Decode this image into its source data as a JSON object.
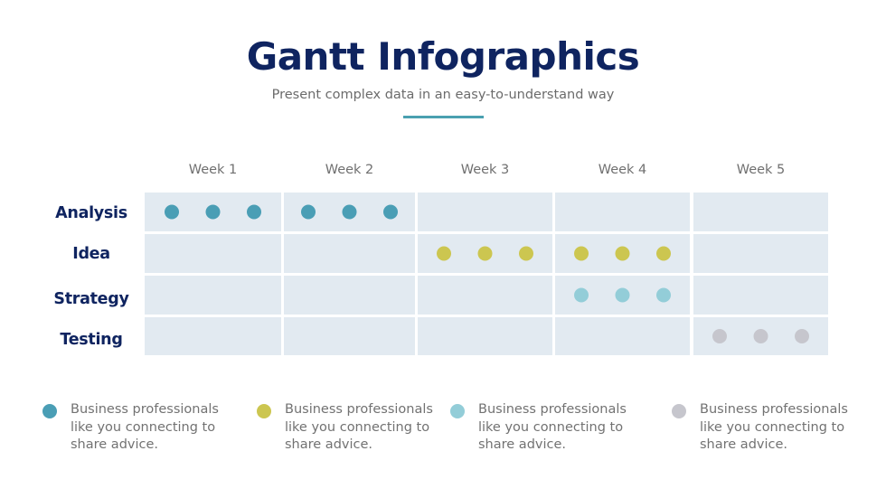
{
  "header": {
    "title": "Gantt Infographics",
    "subtitle": "Present complex data in an easy-to-understand way",
    "accent_color": "#4aa0b0"
  },
  "chart_data": {
    "type": "table",
    "title": "Gantt Infographics",
    "subtitle": "Present complex data in an easy-to-understand way",
    "columns": [
      "Week 1",
      "Week 2",
      "Week 3",
      "Week 4",
      "Week 5"
    ],
    "rows": [
      {
        "label": "Analysis",
        "color": "#4a9eb5",
        "active_weeks": [
          1,
          2
        ],
        "dots_per_week": 3
      },
      {
        "label": "Idea",
        "color": "#ccc650",
        "active_weeks": [
          3,
          4
        ],
        "dots_per_week": 3
      },
      {
        "label": "Strategy",
        "color": "#93cdd8",
        "active_weeks": [
          4
        ],
        "dots_per_week": 3
      },
      {
        "label": "Testing",
        "color": "#c6c6cd",
        "active_weeks": [
          5
        ],
        "dots_per_week": 3
      }
    ],
    "cell_color": "#e2eaf1",
    "legend": [
      {
        "color": "#4a9eb5",
        "text": "Business professionals like you connecting to share advice."
      },
      {
        "color": "#ccc650",
        "text": "Business professionals like you connecting to share advice."
      },
      {
        "color": "#93cdd8",
        "text": "Business professionals like you connecting to share advice."
      },
      {
        "color": "#c6c6cd",
        "text": "Business professionals like you connecting to share advice."
      }
    ]
  }
}
